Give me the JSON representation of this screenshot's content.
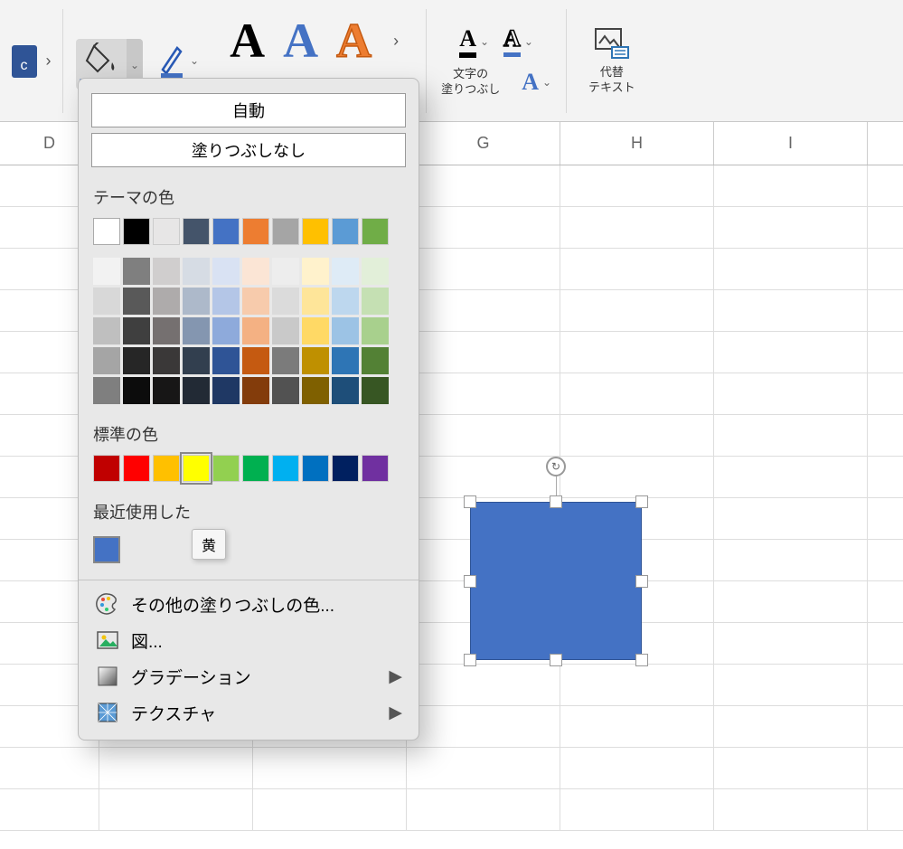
{
  "ribbon": {
    "left_btn_letter": "c",
    "text_fill_label": "文字の\n塗りつぶし",
    "alt_text_label": "代替\nテキスト"
  },
  "columns": [
    "D",
    "",
    "",
    "G",
    "H",
    "I"
  ],
  "popup": {
    "auto": "自動",
    "no_fill": "塗りつぶしなし",
    "theme_title": "テーマの色",
    "theme_row1": [
      "#ffffff",
      "#000000",
      "#e7e6e6",
      "#44546a",
      "#4472c4",
      "#ed7d31",
      "#a5a5a5",
      "#ffc000",
      "#5b9bd5",
      "#70ad47"
    ],
    "tints": [
      [
        "#f2f2f2",
        "#7f7f7f",
        "#d0cece",
        "#d6dce4",
        "#d9e2f3",
        "#fbe5d5",
        "#ededed",
        "#fff2cc",
        "#deebf6",
        "#e2efd9"
      ],
      [
        "#d8d8d8",
        "#595959",
        "#aeabab",
        "#adb9ca",
        "#b4c6e7",
        "#f7cbac",
        "#dbdbdb",
        "#fee599",
        "#bdd7ee",
        "#c5e0b3"
      ],
      [
        "#bfbfbf",
        "#3f3f3f",
        "#757070",
        "#8496b0",
        "#8eaadb",
        "#f4b183",
        "#c9c9c9",
        "#ffd965",
        "#9cc3e5",
        "#a8d08d"
      ],
      [
        "#a5a5a5",
        "#262626",
        "#3a3838",
        "#323f4f",
        "#2f5496",
        "#c55a11",
        "#7b7b7b",
        "#bf9000",
        "#2e75b5",
        "#538135"
      ],
      [
        "#7f7f7f",
        "#0c0c0c",
        "#171616",
        "#222a35",
        "#1f3864",
        "#833c0b",
        "#525252",
        "#7f6000",
        "#1e4e79",
        "#375623"
      ]
    ],
    "standard_title": "標準の色",
    "standard": [
      "#c00000",
      "#ff0000",
      "#ffc000",
      "#ffff00",
      "#92d050",
      "#00b050",
      "#00b0f0",
      "#0070c0",
      "#002060",
      "#7030a0"
    ],
    "recent_title": "最近使用した",
    "recent_color": "#4472c4",
    "tooltip": "黄",
    "more_colors": "その他の塗りつぶしの色...",
    "picture": "図...",
    "gradient": "グラデーション",
    "texture": "テクスチャ"
  }
}
